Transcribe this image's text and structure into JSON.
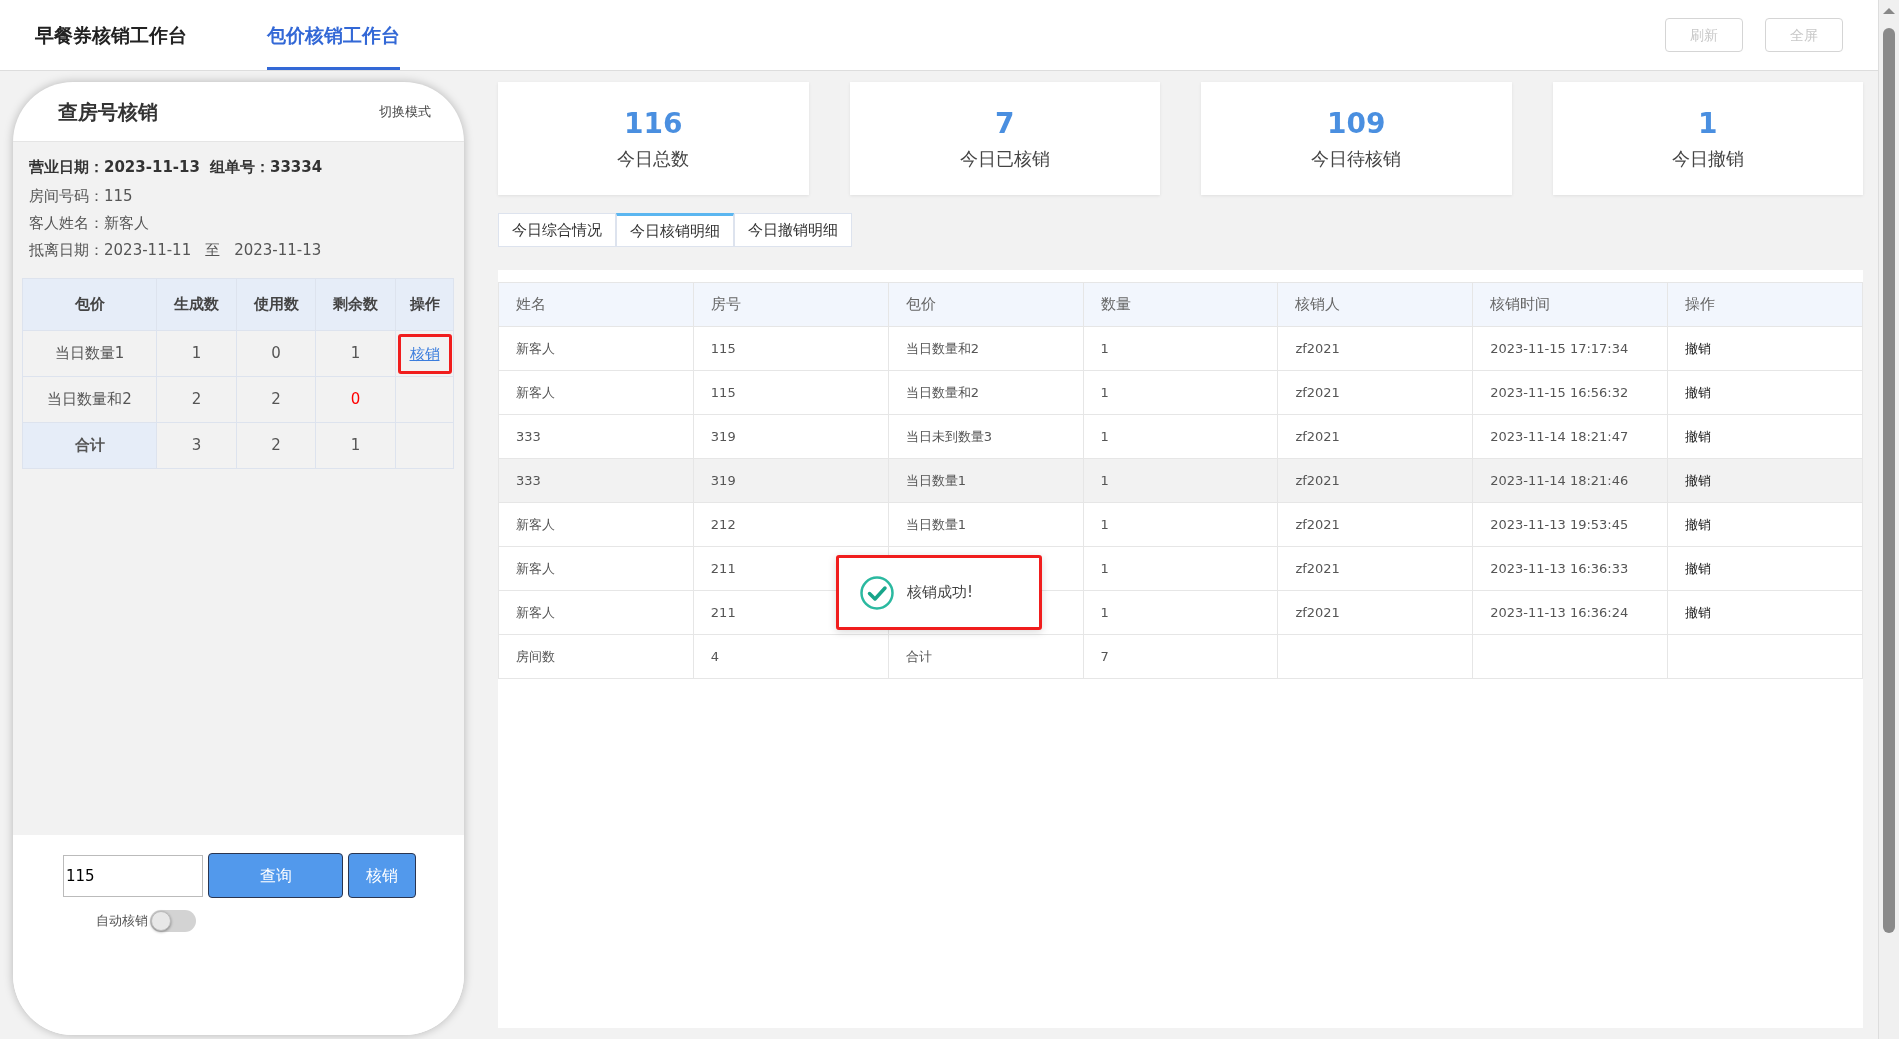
{
  "top_tabs": [
    {
      "label": "早餐券核销工作台",
      "selected": false
    },
    {
      "label": "包价核销工作台",
      "selected": true
    }
  ],
  "top_buttons": [
    "刷新",
    "全屏"
  ],
  "panel": {
    "title": "查房号核销",
    "mode_link": "切换模式",
    "info": [
      {
        "label": "营业日期：",
        "value": "2023-11-13",
        "kind": "header",
        "extra_label": "组单号：",
        "extra_value": "33334"
      },
      {
        "label": "房间号码：",
        "value": "115",
        "kind": "plain"
      },
      {
        "label": "客人姓名：",
        "value": "新客人",
        "kind": "plain"
      },
      {
        "label": "抵离日期：",
        "value": "2023-11-11",
        "kind": "range",
        "sep": "至",
        "extra_value": "2023-11-13"
      }
    ],
    "table": {
      "columns": [
        "包价",
        "生成数",
        "使用数",
        "剩余数",
        "操作"
      ],
      "rows": [
        {
          "kind": "item",
          "cells": [
            "当日数量1",
            "1",
            "0",
            "1"
          ],
          "remaining_warning": false,
          "action": "核销",
          "action_marked": true
        },
        {
          "kind": "item",
          "cells": [
            "当日数量和2",
            "2",
            "2",
            "0"
          ],
          "remaining_warning": true
        },
        {
          "kind": "total",
          "cells": [
            "合计",
            "3",
            "2",
            "1"
          ],
          "remaining_warning": false
        }
      ]
    },
    "room_input": {
      "value": "115"
    },
    "buttons": [
      "查询",
      "核销"
    ],
    "auto_toggle": {
      "label": "自动核销",
      "on": false
    }
  },
  "stats": [
    {
      "value": "116",
      "label": "今日总数"
    },
    {
      "value": "7",
      "label": "今日已核销"
    },
    {
      "value": "109",
      "label": "今日待核销"
    },
    {
      "value": "1",
      "label": "今日撤销"
    }
  ],
  "detail_tabs": [
    {
      "label": "今日综合情况",
      "selected": false
    },
    {
      "label": "今日核销明细",
      "selected": true
    },
    {
      "label": "今日撤销明细",
      "selected": false
    }
  ],
  "detail_table": {
    "columns": [
      "姓名",
      "房号",
      "包价",
      "数量",
      "核销人",
      "核销时间",
      "操作"
    ],
    "rows": [
      {
        "kind": "item",
        "selected": false,
        "cells": [
          "新客人",
          "115",
          "当日数量和2",
          "1",
          "zf2021",
          "2023-11-15 17:17:34",
          "撤销"
        ]
      },
      {
        "kind": "item",
        "selected": false,
        "cells": [
          "新客人",
          "115",
          "当日数量和2",
          "1",
          "zf2021",
          "2023-11-15 16:56:32",
          "撤销"
        ]
      },
      {
        "kind": "item",
        "selected": false,
        "cells": [
          "333",
          "319",
          "当日未到数量3",
          "1",
          "zf2021",
          "2023-11-14 18:21:47",
          "撤销"
        ]
      },
      {
        "kind": "item",
        "selected": true,
        "cells": [
          "333",
          "319",
          "当日数量1",
          "1",
          "zf2021",
          "2023-11-14 18:21:46",
          "撤销"
        ]
      },
      {
        "kind": "item",
        "selected": false,
        "cells": [
          "新客人",
          "212",
          "当日数量1",
          "1",
          "zf2021",
          "2023-11-13 19:53:45",
          "撤销"
        ]
      },
      {
        "kind": "item",
        "selected": false,
        "cells": [
          "新客人",
          "211",
          "",
          "1",
          "zf2021",
          "2023-11-13 16:36:33",
          "撤销"
        ]
      },
      {
        "kind": "item",
        "selected": false,
        "cells": [
          "新客人",
          "211",
          "",
          "1",
          "zf2021",
          "2023-11-13 16:36:24",
          "撤销"
        ]
      },
      {
        "kind": "total",
        "selected": false,
        "cells": [
          "房间数",
          "4",
          "合计",
          "7"
        ]
      }
    ]
  },
  "toast": {
    "message": "核销成功!",
    "marked": true
  }
}
